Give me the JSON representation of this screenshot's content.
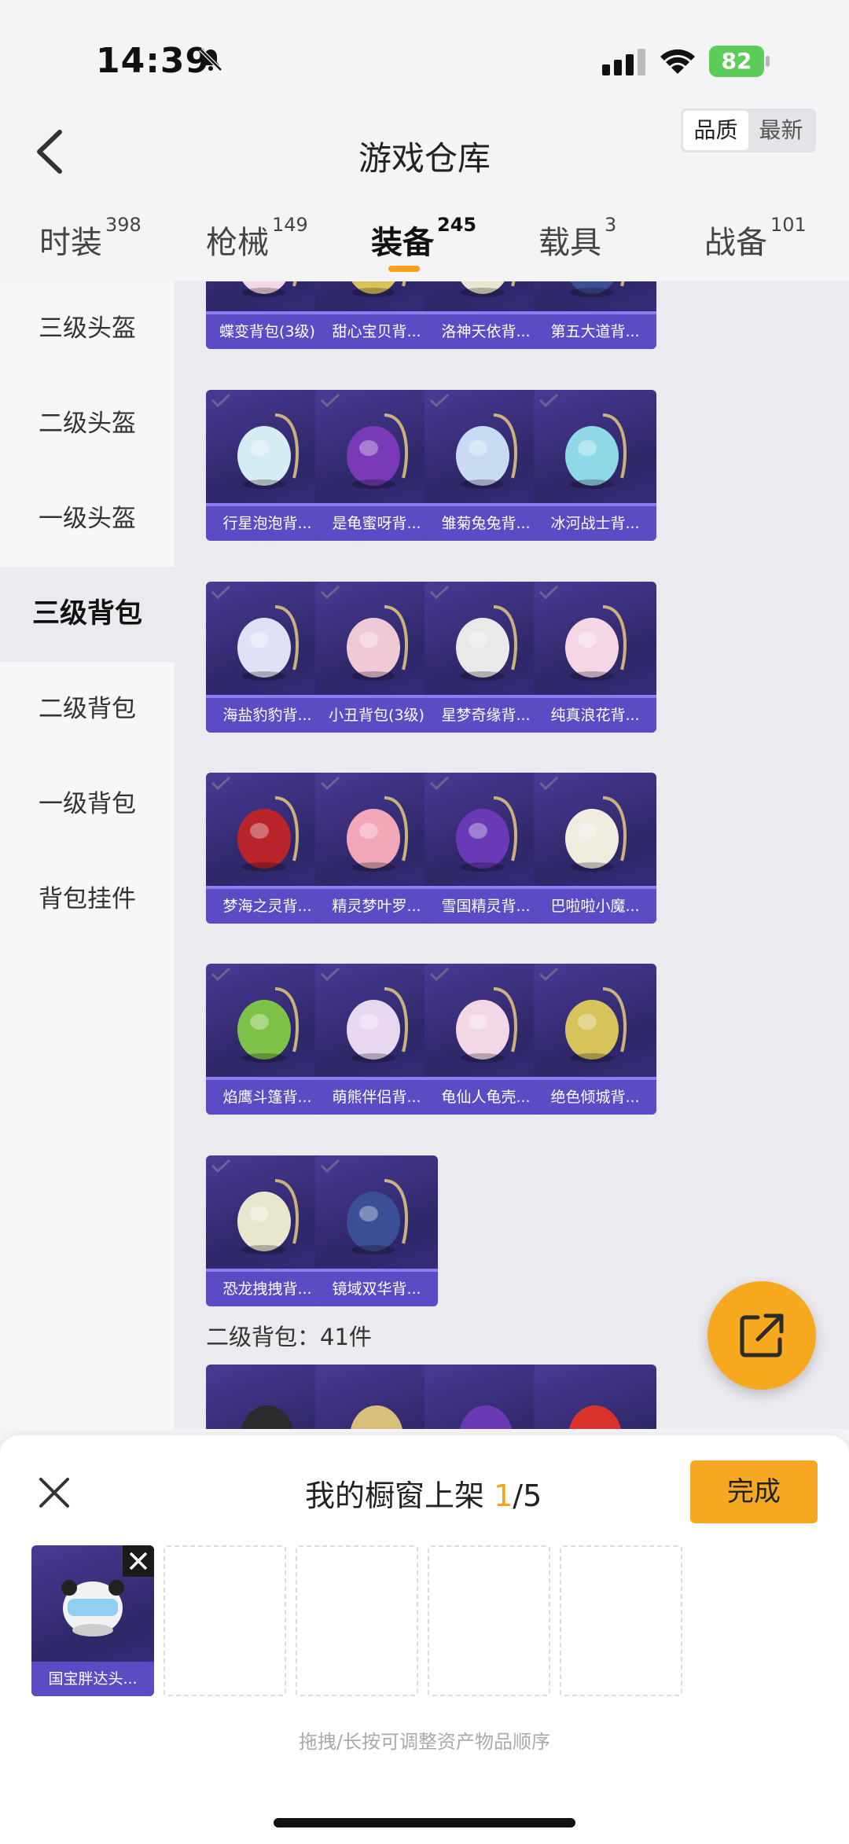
{
  "status_bar": {
    "time": "14:39",
    "battery": "82"
  },
  "header": {
    "title": "游戏仓库",
    "sort_options": [
      "品质",
      "最新"
    ],
    "sort_selected": "品质"
  },
  "tabs": [
    {
      "label": "时装",
      "count": "398"
    },
    {
      "label": "枪械",
      "count": "149"
    },
    {
      "label": "装备",
      "count": "245",
      "active": true
    },
    {
      "label": "载具",
      "count": "3"
    },
    {
      "label": "战备",
      "count": "101"
    }
  ],
  "sidebar": {
    "items": [
      "三级头盔",
      "二级头盔",
      "一级头盔",
      "三级背包",
      "二级背包",
      "一级背包",
      "背包挂件"
    ],
    "active": "三级背包"
  },
  "grid": {
    "items": [
      "蝶变背包(3级)",
      "甜心宝贝背...",
      "洛神天依背...",
      "第五大道背...",
      "行星泡泡背...",
      "是龟蜜呀背...",
      "雏菊兔兔背...",
      "冰河战士背...",
      "海盐豹豹背...",
      "小丑背包(3级)",
      "星梦奇缘背...",
      "纯真浪花背...",
      "梦海之灵背...",
      "精灵梦叶罗...",
      "雪国精灵背...",
      "巴啦啦小魔...",
      "焰鹰斗篷背...",
      "萌熊伴侣背...",
      "龟仙人龟壳...",
      "绝色倾城背...",
      "恐龙拽拽背...",
      "镜域双华背..."
    ],
    "section_label": "二级背包：41件"
  },
  "sheet": {
    "title_prefix": "我的橱窗上架 ",
    "count_current": "1",
    "count_total": "/5",
    "done_label": "完成",
    "slots": [
      {
        "name": "国宝胖达头..."
      }
    ],
    "hint": "拖拽/长按可调整资产物品顺序"
  },
  "colors": {
    "accent": "#f4a21e",
    "card_bg": "#33296f",
    "card_label": "#5b4bc4"
  }
}
